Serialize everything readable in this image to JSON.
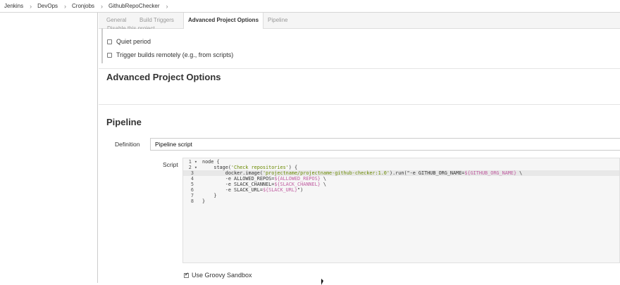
{
  "breadcrumb": [
    "Jenkins",
    "DevOps",
    "Cronjobs",
    "GithubRepoChecker"
  ],
  "tabs": [
    "General",
    "Build Triggers",
    "Advanced Project Options",
    "Pipeline"
  ],
  "general": {
    "cut_label": "Disable this project",
    "quiet_period": "Quiet period",
    "trigger_remote": "Trigger builds remotely (e.g., from scripts)"
  },
  "sections": {
    "advanced": "Advanced Project Options",
    "pipeline": "Pipeline"
  },
  "pipeline": {
    "definition_label": "Definition",
    "definition_value": "Pipeline script",
    "script_label": "Script",
    "lines": [
      {
        "n": "1",
        "fold": "▾"
      },
      {
        "n": "2",
        "fold": "▾"
      },
      {
        "n": "3",
        "fold": ""
      },
      {
        "n": "4",
        "fold": ""
      },
      {
        "n": "5",
        "fold": ""
      },
      {
        "n": "6",
        "fold": ""
      },
      {
        "n": "7",
        "fold": ""
      },
      {
        "n": "8",
        "fold": ""
      }
    ],
    "code": {
      "l1": "node {",
      "l2a": "    stage(",
      "l2b": "'Check repositories'",
      "l2c": ") {",
      "l3a": "        docker.image(",
      "l3b": "'projectname/projectname-github-checker:1.0'",
      "l3c": ").run(\"-e GITHUB_ORG_NAME=",
      "l3d": "${GITHUB_ORG_NAME}",
      "l3e": " \\",
      "l4a": "        -e ALLOWED_REPOS=",
      "l4b": "${ALLOWED_REPOS}",
      "l4c": " \\",
      "l5a": "        -e SLACK_CHANNEL=",
      "l5b": "${SLACK_CHANNEL}",
      "l5c": " \\",
      "l6a": "        -e SLACK_URL=",
      "l6b": "${SLACK_URL}",
      "l6c": "\")",
      "l7": "    }",
      "l8": "}"
    },
    "sandbox_label": "Use Groovy Sandbox",
    "sandbox_checked": true
  }
}
